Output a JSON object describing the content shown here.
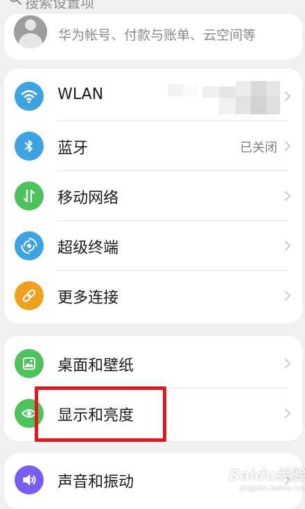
{
  "search": {
    "placeholder": "搜索设置项"
  },
  "account": {
    "subtitle": "华为帐号、付款与账单、云空间等"
  },
  "groups": {
    "connectivity": [
      {
        "label": "WLAN",
        "value": "",
        "icon": "wifi-icon",
        "color": "#3ea3e0"
      },
      {
        "label": "蓝牙",
        "value": "已关闭",
        "icon": "bluetooth-icon",
        "color": "#3ea3e0"
      },
      {
        "label": "移动网络",
        "value": "",
        "icon": "mobile-network-icon",
        "color": "#4ec25c"
      },
      {
        "label": "超级终端",
        "value": "",
        "icon": "super-device-icon",
        "color": "#3ea3e0"
      },
      {
        "label": "更多连接",
        "value": "",
        "icon": "link-icon",
        "color": "#f0a020"
      }
    ],
    "display": [
      {
        "label": "桌面和壁纸",
        "value": "",
        "icon": "wallpaper-icon",
        "color": "#4ec25c"
      },
      {
        "label": "显示和亮度",
        "value": "",
        "icon": "eye-icon",
        "color": "#4ec25c"
      }
    ],
    "sound": [
      {
        "label": "声音和振动",
        "value": "",
        "icon": "speaker-icon",
        "color": "#7a5cf0"
      }
    ]
  },
  "annotation": {
    "highlight_color": "#e3151f"
  },
  "watermark": {
    "text": "Baidu经验",
    "sub": "jingyan.baidu.com"
  }
}
